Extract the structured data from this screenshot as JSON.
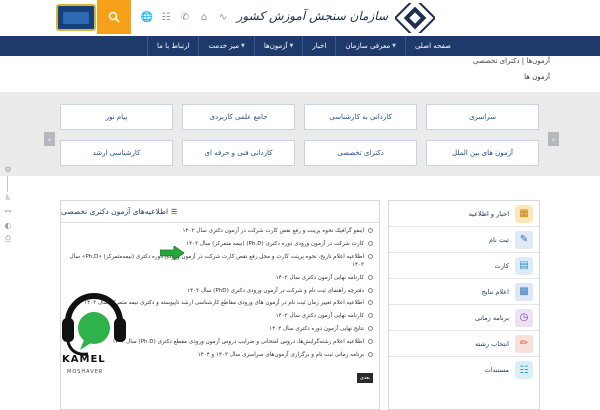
{
  "header": {
    "site_name": "سازمان سنجش آموزش کشور",
    "icons": [
      "rss-icon",
      "home-icon",
      "phone-icon",
      "sitemap-icon",
      "globe-icon"
    ]
  },
  "nav": {
    "items": [
      {
        "label": "صفحه اصلی",
        "caret": false
      },
      {
        "label": "معرفی سازمان",
        "caret": true
      },
      {
        "label": "اخبار",
        "caret": false
      },
      {
        "label": "آزمون‌ها",
        "caret": true
      },
      {
        "label": "میز خدمت",
        "caret": true
      },
      {
        "label": "ارتباط با ما",
        "caret": false
      }
    ]
  },
  "breadcrumb": {
    "text": "آزمون‌ها  | دکترای تخصصی",
    "title": "آزمون ها"
  },
  "categories": [
    "پیام نور",
    "جامع علمی کاربردی",
    "کاردانی به کارشناسی",
    "سراسری",
    "آزمون های بین الملل",
    "دکترای تخصصی",
    "کاردانی فنی و حرفه ای",
    "کارشناسی ارشد"
  ],
  "announcements": {
    "title": "اطلاعیه‌های آزمون دکتری تخصصی",
    "items": [
      "اینفو گرافیک نحوه پرینت و رفع نقص کارت شرکت در آزمون دکتری سال ۱۴۰۳",
      "کارت شرکت در آزمون ورودی دوره دکتری (Ph.D) (نیمه متمرکز) سال ۱۴۰۳",
      "اطلاعیه اعلام تاریخ، نحوه پرینت کارت و محل رفع نقص کارت شرکت در آزمون ورودی دوره دکتری (نیمه‌متمرکز) «Ph.D» سال ۱۴۰۳",
      "کارنامه نهایی آزمون دکتری سال ۱۴۰۲",
      "دفترچه راهنمای ثبت نام و شرکت در آزمون ورودی دکتری (PhD) سال ۱۴۰۳",
      "اطلاعیه اعلام تغییر زمان ثبت نام در آزمون های ورودی مقاطع کارشناسی ارشد ناپیوسته و دکتری نیمه متمرکز سال ۱۴۰۳",
      "کارنامه نهایی آزمون دکتری سال ۱۴۰۲",
      "نتایج نهایی آزمون دوره دکتری سال ۱۴۰۲",
      "اطلاعیه اعلام رشته‌گرایش‌ها، دروس امتحانی و ضرایب دروس آزمون ورودی مقطع دکتری (Ph.D) سال ۱۴۰۳",
      "برنامه زمانی ثبت نام و برگزاری آزمون‌های سراسری سال ۱۴۰۳ و ۱۴۰۴"
    ],
    "more_label": "بعدی"
  },
  "menu": {
    "items": [
      {
        "label": "اخبار و اطلاعیه",
        "icon": "newspaper-icon",
        "color": "#e7a631"
      },
      {
        "label": "ثبت نام",
        "icon": "clipboard-icon",
        "color": "#2d6db5"
      },
      {
        "label": "کارت",
        "icon": "id-card-icon",
        "color": "#2e8fc9"
      },
      {
        "label": "اعلام نتایج",
        "icon": "results-icon",
        "color": "#3a7bbf"
      },
      {
        "label": "برنامه زمانی",
        "icon": "calendar-icon",
        "color": "#7b4aa6"
      },
      {
        "label": "انتخاب رشته",
        "icon": "pencil-icon",
        "color": "#d65a3a"
      },
      {
        "label": "مستندات",
        "icon": "documents-icon",
        "color": "#2d9ec9"
      }
    ]
  },
  "watermark": {
    "name": "KAMEL",
    "subtitle": "MOSHAVER"
  }
}
